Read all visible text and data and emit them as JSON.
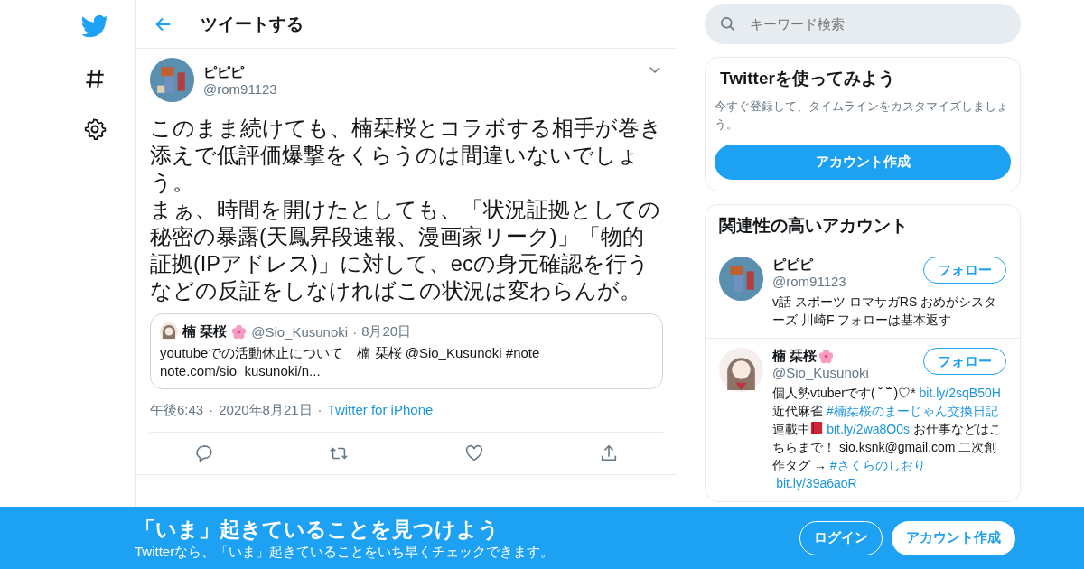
{
  "header": {
    "title": "ツイートする"
  },
  "search": {
    "placeholder": "キーワード検索"
  },
  "tweet": {
    "name": "ピピピ",
    "handle": "@rom91123",
    "paragraphs": [
      "このまま続けても、楠栞桜とコラボする相手が巻き添えで低評価爆撃をくらうのは間違いないでしょう。",
      "まぁ、時間を開けたとしても、「状況証拠としての秘密の暴露(天鳳昇段速報、漫画家リーク)」「物的証拠(IPアドレス)」に対して、ecの身元確認を行うなどの反証をしなければこの状況は変わらんが。"
    ],
    "quote": {
      "name": "楠 栞桜",
      "handle": "@Sio_Kusunoki",
      "sep": "·",
      "date": "8月20日",
      "text": "youtubeでの活動休止について｜楠 栞桜 @Sio_Kusunoki #note\nnote.com/sio_kusunoki/n..."
    },
    "time": "午後6:43",
    "sep1": "·",
    "date": "2020年8月21日",
    "sep2": "·",
    "source": "Twitter for iPhone"
  },
  "signup": {
    "title": "Twitterを使ってみよう",
    "text": "今すぐ登録して、タイムラインをカスタマイズしましょう。",
    "button": "アカウント作成"
  },
  "related": {
    "title": "関連性の高いアカウント",
    "accounts": [
      {
        "name": "ピピピ",
        "flower": false,
        "handle": "@rom91123",
        "follow": "フォロー",
        "bio": [
          {
            "kind": "text",
            "text": "v話 スポーツ ロマサガRS おめがシスターズ 川崎F フォローは基本返す"
          }
        ]
      },
      {
        "name": "楠 栞桜",
        "flower": true,
        "handle": "@Sio_Kusunoki",
        "follow": "フォロー",
        "bio": [
          {
            "kind": "text",
            "text": "個人勢vtuberです( ˘ ˘̆ )♡* "
          },
          {
            "kind": "link",
            "text": "bit.ly/2sqB50H"
          },
          {
            "kind": "text",
            "text": " 近代麻雀 "
          },
          {
            "kind": "link",
            "text": "#楠栞桜のまーじゃん交換日記"
          },
          {
            "kind": "text",
            "text": " 連載中"
          },
          {
            "kind": "book"
          },
          {
            "kind": "link",
            "text": "bit.ly/2wa8O0s"
          },
          {
            "kind": "text",
            "text": " お仕事などはこちらまで！ sio.ksnk@gmail.com 二次創作タグ → "
          },
          {
            "kind": "link",
            "text": "#さくらのしおり"
          },
          {
            "kind": "link",
            "text": "bit.ly/39a6aoR"
          }
        ]
      }
    ]
  },
  "banner": {
    "title": "「いま」起きていることを見つけよう",
    "text": "Twitterなら、「いま」起きていることをいち早くチェックできます。",
    "login": "ログイン",
    "signup": "アカウント作成"
  }
}
